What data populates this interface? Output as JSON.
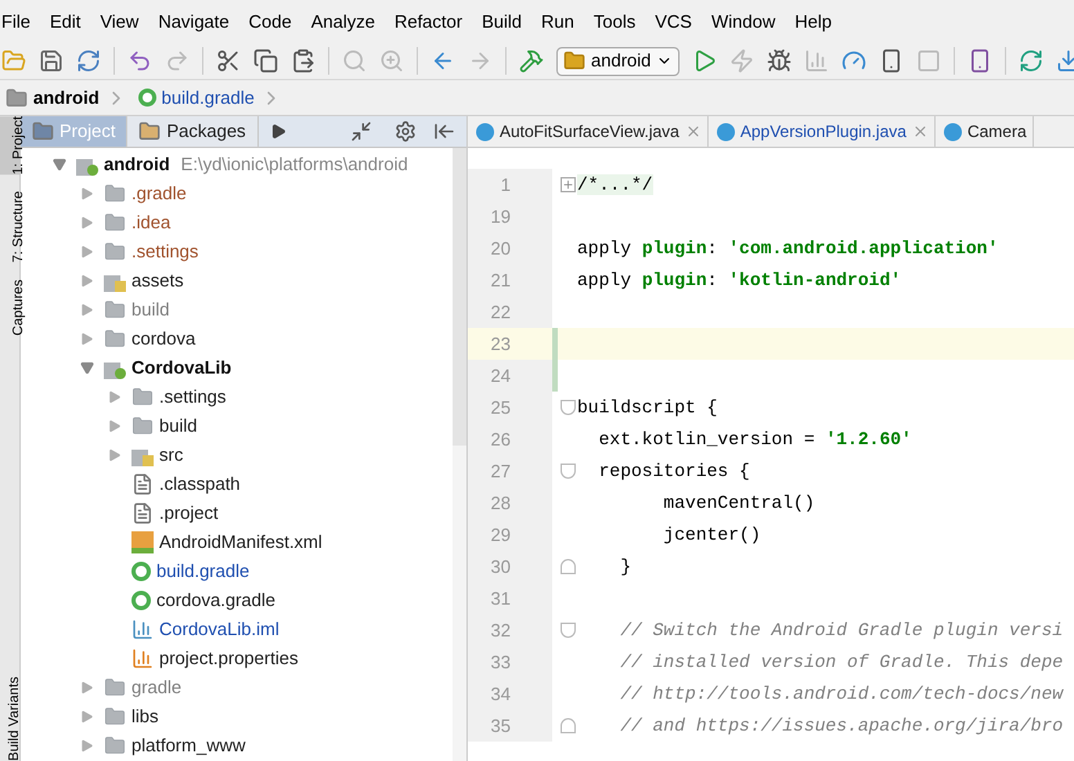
{
  "menu": [
    "File",
    "Edit",
    "View",
    "Navigate",
    "Code",
    "Analyze",
    "Refactor",
    "Build",
    "Run",
    "Tools",
    "VCS",
    "Window",
    "Help"
  ],
  "toolbar": {
    "run_config": "android"
  },
  "breadcrumb": [
    {
      "label": "android",
      "kind": "folder"
    },
    {
      "label": "build.gradle",
      "kind": "gradle"
    }
  ],
  "tool_stripe": [
    "1: Project",
    "7: Structure",
    "Captures",
    "Build Variants"
  ],
  "panel_tabs": [
    {
      "label": "Project",
      "selected": true
    },
    {
      "label": "Packages",
      "selected": false
    }
  ],
  "tree": [
    {
      "label": "android",
      "kind": "module",
      "color": "#111111",
      "detail": "E:\\yd\\ionic\\platforms\\android",
      "expanded": true,
      "children": [
        {
          "label": ".gradle",
          "kind": "folder",
          "color": "#a0522d",
          "expanded": false
        },
        {
          "label": ".idea",
          "kind": "folder",
          "color": "#a0522d",
          "expanded": false
        },
        {
          "label": ".settings",
          "kind": "folder",
          "color": "#a0522d",
          "expanded": false
        },
        {
          "label": "assets",
          "kind": "source",
          "color": "#222222",
          "expanded": false
        },
        {
          "label": "build",
          "kind": "folder",
          "color": "#808080",
          "expanded": false
        },
        {
          "label": "cordova",
          "kind": "folder",
          "color": "#222222",
          "expanded": false
        },
        {
          "label": "CordovaLib",
          "kind": "module",
          "color": "#111111",
          "expanded": true,
          "children": [
            {
              "label": ".settings",
              "kind": "folder",
              "color": "#222222",
              "expanded": false
            },
            {
              "label": "build",
              "kind": "folder",
              "color": "#222222",
              "expanded": false
            },
            {
              "label": "src",
              "kind": "source",
              "color": "#222222",
              "expanded": false
            },
            {
              "label": ".classpath",
              "kind": "text",
              "color": "#222222"
            },
            {
              "label": ".project",
              "kind": "text",
              "color": "#222222"
            },
            {
              "label": "AndroidManifest.xml",
              "kind": "xml",
              "color": "#222222"
            },
            {
              "label": "build.gradle",
              "kind": "gradle",
              "color": "#1f4fb0"
            },
            {
              "label": "cordova.gradle",
              "kind": "gradle",
              "color": "#222222"
            },
            {
              "label": "CordovaLib.iml",
              "kind": "iml",
              "color": "#1f4fb0"
            },
            {
              "label": "project.properties",
              "kind": "properties",
              "color": "#222222"
            }
          ]
        },
        {
          "label": "gradle",
          "kind": "folder",
          "color": "#808080",
          "expanded": false
        },
        {
          "label": "libs",
          "kind": "folder",
          "color": "#222222",
          "expanded": false
        },
        {
          "label": "platform_www",
          "kind": "folder",
          "color": "#222222",
          "expanded": false
        }
      ]
    }
  ],
  "editor_tabs": [
    {
      "label": "AutoFitSurfaceView.java",
      "selected": false
    },
    {
      "label": "AppVersionPlugin.java",
      "selected": false
    },
    {
      "label": "Camera",
      "selected": false
    }
  ],
  "code": [
    {
      "number": "1",
      "folded": true,
      "tokens": [
        {
          "text": "/*...*/",
          "kind": "folded"
        }
      ]
    },
    {
      "number": "19"
    },
    {
      "number": "20",
      "tokens": [
        {
          "text": "apply ",
          "kind": "plain"
        },
        {
          "text": "plugin",
          "kind": "key"
        },
        {
          "text": ": ",
          "kind": "plain"
        },
        {
          "text": "'com.android.application'",
          "kind": "string"
        }
      ]
    },
    {
      "number": "21",
      "tokens": [
        {
          "text": "apply ",
          "kind": "plain"
        },
        {
          "text": "plugin",
          "kind": "key"
        },
        {
          "text": ": ",
          "kind": "plain"
        },
        {
          "text": "'kotlin-android'",
          "kind": "string"
        }
      ]
    },
    {
      "number": "22"
    },
    {
      "number": "23",
      "current": true,
      "changed": true
    },
    {
      "number": "24",
      "changed": true
    },
    {
      "number": "25",
      "fold_start": true,
      "tokens": [
        {
          "text": "buildscript {",
          "kind": "plain"
        }
      ]
    },
    {
      "number": "26",
      "tokens": [
        {
          "text": "  ext.kotlin_version = ",
          "kind": "plain"
        },
        {
          "text": "'1.2.60'",
          "kind": "string"
        }
      ]
    },
    {
      "number": "27",
      "fold_start": true,
      "tokens": [
        {
          "text": "  repositories {",
          "kind": "plain"
        }
      ]
    },
    {
      "number": "28",
      "tokens": [
        {
          "text": "        mavenCentral()",
          "kind": "plain"
        }
      ]
    },
    {
      "number": "29",
      "tokens": [
        {
          "text": "        jcenter()",
          "kind": "plain"
        }
      ]
    },
    {
      "number": "30",
      "fold_end": true,
      "tokens": [
        {
          "text": "    }",
          "kind": "plain"
        }
      ]
    },
    {
      "number": "31"
    },
    {
      "number": "32",
      "fold_start": true,
      "tokens": [
        {
          "text": "    // Switch the Android Gradle plugin versi",
          "kind": "comment"
        }
      ]
    },
    {
      "number": "33",
      "tokens": [
        {
          "text": "    // installed version of Gradle. This depe",
          "kind": "comment"
        }
      ]
    },
    {
      "number": "34",
      "tokens": [
        {
          "text": "    // http://tools.android.com/tech-docs/new",
          "kind": "comment"
        }
      ]
    },
    {
      "number": "35",
      "fold_end": true,
      "tokens": [
        {
          "text": "    // and https://issues.apache.org/jira/bro",
          "kind": "comment"
        }
      ]
    }
  ]
}
